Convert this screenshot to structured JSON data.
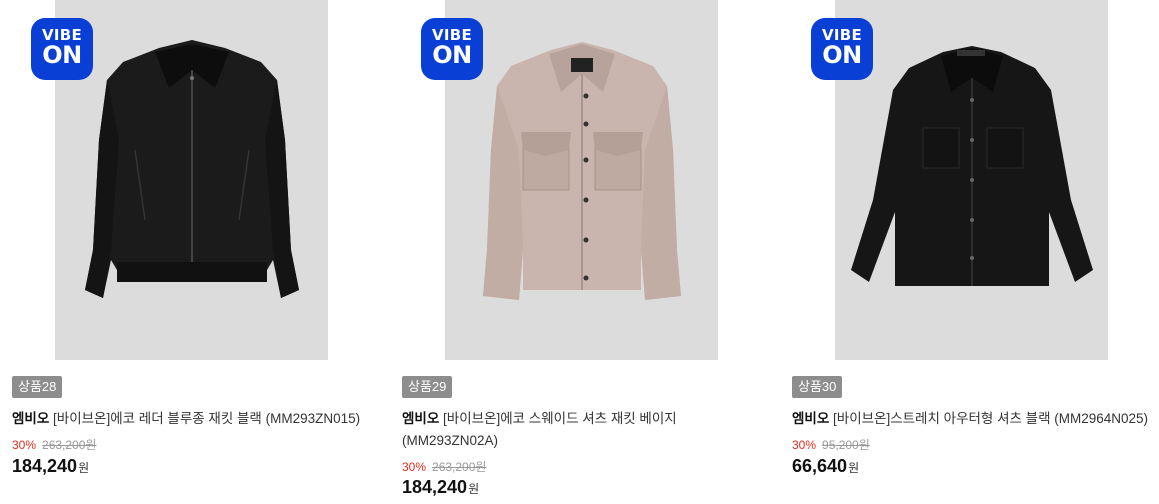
{
  "products": [
    {
      "badge_top": "VIBE",
      "badge_bottom": "ON",
      "tag": "상품28",
      "brand": "엠비오",
      "name": "[바이브온]에코 레더 블루종 재킷 블랙 (MM293ZN015)",
      "discount": "30%",
      "original_price": "263,200원",
      "price": "184,240",
      "currency": "원",
      "image_icon": "black-leather-jacket",
      "colors": {
        "image_bg": "#dcdcdc",
        "garment": "#1a1a1a"
      }
    },
    {
      "badge_top": "VIBE",
      "badge_bottom": "ON",
      "tag": "상품29",
      "brand": "엠비오",
      "name": "[바이브온]에코 스웨이드 셔츠 재킷 베이지",
      "name_line2": "(MM293ZN02A)",
      "discount": "30%",
      "original_price": "263,200원",
      "price": "184,240",
      "currency": "원",
      "image_icon": "beige-suede-jacket",
      "colors": {
        "image_bg": "#dcdcdc",
        "garment": "#c9b5ae"
      }
    },
    {
      "badge_top": "VIBE",
      "badge_bottom": "ON",
      "tag": "상품30",
      "brand": "엠비오",
      "name": "[바이브온]스트레치 아우터형 셔츠 블랙 (MM2964N025)",
      "discount": "30%",
      "original_price": "95,200원",
      "price": "66,640",
      "currency": "원",
      "image_icon": "black-overshirt",
      "colors": {
        "image_bg": "#dcdcdc",
        "garment": "#161616"
      }
    }
  ],
  "colors": {
    "badge": "#0a3fd6",
    "tag_bg": "#8d8d8d",
    "discount": "#e0301e"
  }
}
